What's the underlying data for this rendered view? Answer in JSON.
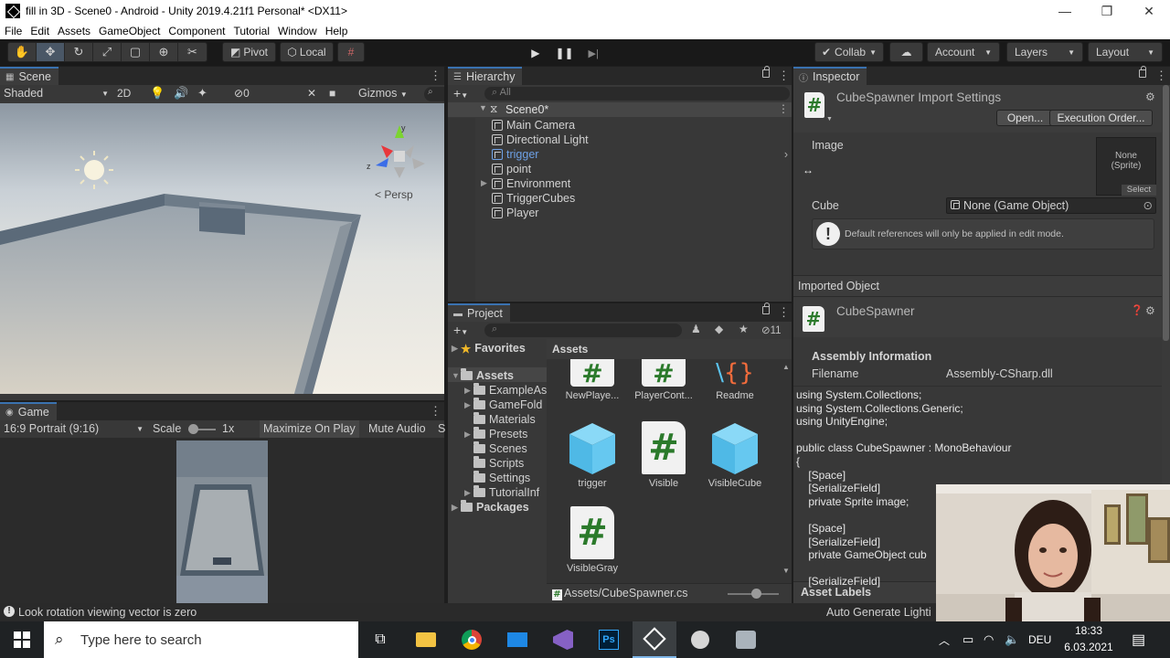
{
  "window": {
    "title": "fill in 3D - Scene0 - Android - Unity 2019.4.21f1 Personal* <DX11>",
    "min": "—",
    "restore": "❐",
    "close": "✕"
  },
  "menu": [
    "File",
    "Edit",
    "Assets",
    "GameObject",
    "Component",
    "Tutorial",
    "Window",
    "Help"
  ],
  "toolbar": {
    "pivot": "Pivot",
    "local": "Local",
    "collab": "Collab",
    "account": "Account",
    "layers": "Layers",
    "layout": "Layout"
  },
  "scene": {
    "tab": "Scene",
    "shading": "Shaded",
    "mode2d": "2D",
    "gizmos": "Gizmos",
    "hidden_count": "0",
    "persp": "< Persp",
    "search_placeholder": ""
  },
  "game": {
    "tab": "Game",
    "aspect": "16:9 Portrait (9:16)",
    "scale_label": "Scale",
    "scale_value": "1x",
    "maximize": "Maximize On Play",
    "mute": "Mute Audio",
    "stats": "S"
  },
  "hierarchy": {
    "tab": "Hierarchy",
    "search_placeholder": "All",
    "scene_name": "Scene0*",
    "items": [
      {
        "label": "Main Camera",
        "selected": false,
        "expand": false
      },
      {
        "label": "Directional Light",
        "selected": false,
        "expand": false
      },
      {
        "label": "trigger",
        "selected": true,
        "expand": false
      },
      {
        "label": "point",
        "selected": false,
        "expand": false
      },
      {
        "label": "Environment",
        "selected": false,
        "expand": true
      },
      {
        "label": "TriggerCubes",
        "selected": false,
        "expand": false
      },
      {
        "label": "Player",
        "selected": false,
        "expand": false
      }
    ]
  },
  "project": {
    "tab": "Project",
    "hidden_count": "11",
    "favorites": "Favorites",
    "assets_root": "Assets",
    "packages": "Packages",
    "folders": [
      "ExampleAs",
      "GameFold",
      "Materials",
      "Presets",
      "Scenes",
      "Scripts",
      "Settings",
      "TutorialInf"
    ],
    "breadcrumb": "Assets",
    "assets": [
      {
        "label": "NewPlaye...",
        "kind": "cs"
      },
      {
        "label": "PlayerCont...",
        "kind": "cs"
      },
      {
        "label": "Readme",
        "kind": "json"
      },
      {
        "label": "trigger",
        "kind": "cube"
      },
      {
        "label": "Visible",
        "kind": "cs"
      },
      {
        "label": "VisibleCube",
        "kind": "cube"
      },
      {
        "label": "VisibleGray",
        "kind": "cs"
      }
    ],
    "footer_path": "Assets/CubeSpawner.cs"
  },
  "inspector": {
    "tab": "Inspector",
    "title": "CubeSpawner Import Settings",
    "open": "Open...",
    "execution_order": "Execution Order...",
    "image_label": "Image",
    "image_value": "None\n(Sprite)",
    "image_select": "Select",
    "cube_label": "Cube",
    "cube_value": "None (Game Object)",
    "info": "Default references will only be applied in edit mode.",
    "imported_object": "Imported Object",
    "object_name": "CubeSpawner",
    "assembly_info": "Assembly Information",
    "filename_label": "Filename",
    "filename_value": "Assembly-CSharp.dll",
    "code": "using System.Collections;\nusing System.Collections.Generic;\nusing UnityEngine;\n\npublic class CubeSpawner : MonoBehaviour\n{\n    [Space]\n    [SerializeField]\n    private Sprite image;\n\n    [Space]\n    [SerializeField]\n    private GameObject cub\n\n    [SerializeField]",
    "asset_labels": "Asset Labels",
    "auto_generate": "Auto Generate Lighti"
  },
  "status": {
    "message": "Look rotation viewing vector is zero"
  },
  "taskbar": {
    "search_placeholder": "Type here to search",
    "language": "DEU",
    "time": "18:33",
    "date": "6.03.2021"
  },
  "colors": {
    "accent": "#3a72b0",
    "selected_text": "#6ea1e6",
    "cs_icon": "#2b7a2b",
    "cube_blue": "#5bc4f0",
    "readme_orange": "#f26c3c"
  }
}
